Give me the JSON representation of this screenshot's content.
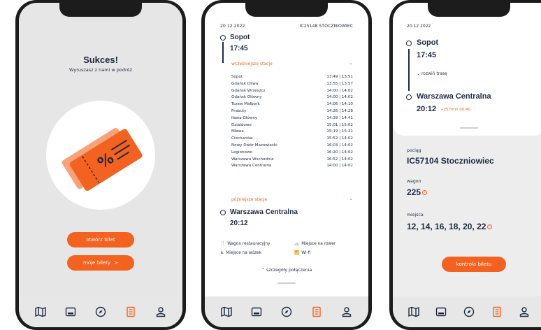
{
  "screen1": {
    "title": "Sukces!",
    "subtitle": "Wyruszasz z nami w podróż",
    "open_ticket_label": "otwórz bilet",
    "my_tickets_label": "moje bilety",
    "my_tickets_arrow": ">"
  },
  "screen2": {
    "date": "20.12.2022",
    "train": "IC25148 STOCZNIOWIEC",
    "from_station": "Sopot",
    "from_time": "17:45",
    "earlier_link": "wcześniejsze stacje",
    "later_link": "późniejsze stacje",
    "stops": [
      {
        "name": "Sopot",
        "times": "13:49 | 13:51"
      },
      {
        "name": "Gdańsk Oliwa",
        "times": "13:55 | 13:57"
      },
      {
        "name": "Gdańsk Wrzeszcz",
        "times": "14:00 | 14:02"
      },
      {
        "name": "Gdańsk Główny",
        "times": "14:00 | 14:02"
      },
      {
        "name": "Tczew Malbork",
        "times": "14:06 | 14:10"
      },
      {
        "name": "Prabuty",
        "times": "14:26 | 14:28"
      },
      {
        "name": "Iława Główny",
        "times": "14:39 | 14:41"
      },
      {
        "name": "Działdowo",
        "times": "15:01 | 15:02"
      },
      {
        "name": "Mława",
        "times": "15:19 | 15:21"
      },
      {
        "name": "Ciechanów",
        "times": "15:52 | 14:02"
      },
      {
        "name": "Nowy Dwór Mazowiecki",
        "times": "16:03 | 14:02"
      },
      {
        "name": "Legionowo",
        "times": "16:20 | 14:02"
      },
      {
        "name": "Warszawa Wschodnia",
        "times": "16:52 | 14:02"
      },
      {
        "name": "Warszawa Centralna",
        "times": "14:00 | 14:02"
      }
    ],
    "to_station": "Warszawa Centralna",
    "to_time": "20:12",
    "amenities": {
      "restaurant": "Wagon restauracyjny",
      "bike": "Miejsce na rower",
      "wheelchair": "Miejsce na wózek",
      "wifi": "Wi-fi"
    },
    "details_link": "szczegóły połączenia"
  },
  "screen3": {
    "date": "20.12.2022",
    "from_station": "Sopot",
    "from_time": "17:45",
    "expand_route": "rozwiń trasę",
    "to_station": "Warszawa Centralna",
    "to_time": "20:12",
    "delay": "+257min 00:40",
    "train_label": "pociąg",
    "train_value": "IC57104 Stoczniowiec",
    "wagon_label": "wagon",
    "wagon_value": "225",
    "seats_label": "miejsca",
    "seats_value": "12, 14, 16, 18, 20, 22",
    "check_ticket_label": "kontrola biletu"
  },
  "nav_icons": [
    "map-icon",
    "wallet-icon",
    "compass-icon",
    "ticket-icon",
    "profile-icon"
  ],
  "colors": {
    "accent": "#f4621f",
    "navy": "#1f2a44",
    "nav_active": "#f4621f"
  }
}
